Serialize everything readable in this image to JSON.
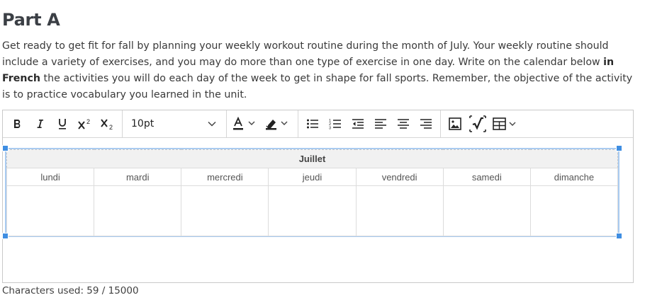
{
  "part_title": "Part A",
  "instructions": {
    "text_1": "Get ready to get fit for fall by planning your weekly workout routine during the month of July. Your weekly routine should include a variety of exercises, and you may do more than one type of exercise in one day. Write on the calendar below ",
    "bold": "in French",
    "text_2": " the activities you will do each day of the week to get in shape for fall sports. Remember, the objective of the activity is to practice vocabulary you learned in the unit."
  },
  "toolbar": {
    "font_size": "10pt",
    "icons": [
      "bold-icon",
      "italic-icon",
      "underline-icon",
      "superscript-icon",
      "subscript-icon",
      "font-size-select",
      "text-color-icon",
      "highlight-color-icon",
      "bulleted-list-icon",
      "numbered-list-icon",
      "outdent-icon",
      "align-left-icon",
      "align-center-icon",
      "align-right-icon",
      "image-icon",
      "math-icon",
      "table-icon"
    ]
  },
  "table": {
    "month": "Juillet",
    "days": [
      "lundi",
      "mardi",
      "mercredi",
      "jeudi",
      "vendredi",
      "samedi",
      "dimanche"
    ]
  },
  "footer": {
    "label": "Characters used:",
    "count": "59 / 15000"
  }
}
